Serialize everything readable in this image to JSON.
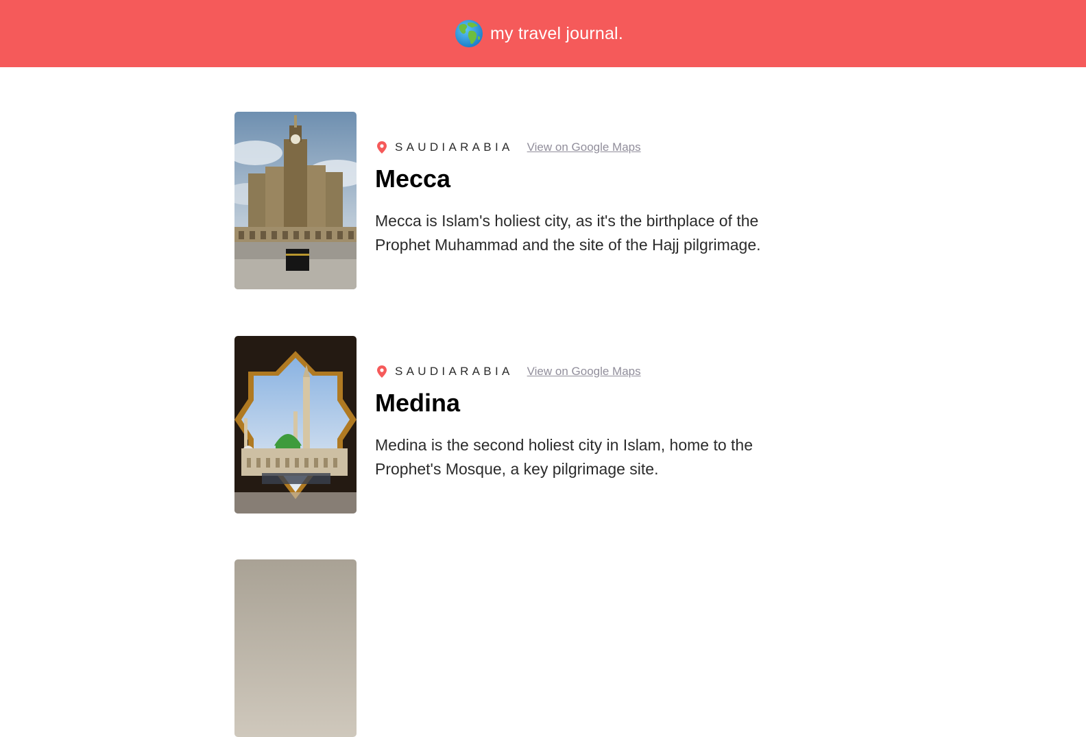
{
  "header": {
    "icon": "globe-icon",
    "title": "my travel journal.",
    "background": "#F55A5A"
  },
  "entries": [
    {
      "country": "SAUDIARABIA",
      "maps_link": "View on Google Maps",
      "title": "Mecca",
      "description": "Mecca is Islam's holiest city, as it's the birthplace of the Prophet Muhammad and the site of the Hajj pilgrimage.",
      "image": "mecca-clock-tower-photo"
    },
    {
      "country": "SAUDIARABIA",
      "maps_link": "View on Google Maps",
      "title": "Medina",
      "description": "Medina is the second holiest city in Islam, home to the Prophet's Mosque, a key pilgrimage site.",
      "image": "medina-prophets-mosque-photo"
    }
  ],
  "colors": {
    "accent": "#F55A5A",
    "link": "#918E9B",
    "text": "#2B2B2B"
  }
}
